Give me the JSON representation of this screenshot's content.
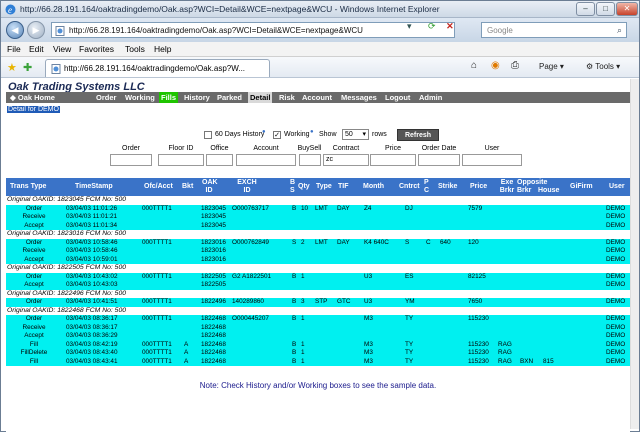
{
  "window": {
    "title": "http://66.28.191.164/oaktradingdemo/Oak.asp?WCI=Detail&WCE=nextpage&WCU - Windows Internet Explorer",
    "minimize": "–",
    "maximize": "□",
    "close": "✕"
  },
  "address": {
    "url": "http://66.28.191.164/oaktradingdemo/Oak.asp?WCI=Detail&WCE=nextpage&WCU",
    "search_placeholder": "Google"
  },
  "menu": [
    "File",
    "Edit",
    "View",
    "Favorites",
    "Tools",
    "Help"
  ],
  "tab": {
    "label": "http://66.28.191.164/oaktradingdemo/Oak.asp?W..."
  },
  "commands": {
    "page": "Page",
    "tools": "Tools"
  },
  "site": {
    "brand": "Oak Trading Systems LLC",
    "nav": [
      "Oak Home",
      "Order",
      "Working",
      "Fills",
      "History",
      "Parked",
      "Detail",
      "Risk",
      "Account",
      "Messages",
      "Logout",
      "Admin"
    ],
    "detail_for": "Detail for DEMO"
  },
  "filters": {
    "history_label": "60 Days History",
    "working_label": "Working",
    "history_checked": false,
    "working_checked": true,
    "show_label": "Show",
    "show_value": "50",
    "rows_label": "rows",
    "refresh": "Refresh",
    "fields": [
      {
        "label": "Order",
        "value": ""
      },
      {
        "label": "Floor ID",
        "value": ""
      },
      {
        "label": "Office",
        "value": ""
      },
      {
        "label": "Account",
        "value": ""
      },
      {
        "label": "BuySell",
        "value": ""
      },
      {
        "label": "Contract",
        "value": "zc"
      },
      {
        "label": "Price",
        "value": ""
      },
      {
        "label": "Order Date",
        "value": ""
      },
      {
        "label": "User",
        "value": ""
      }
    ]
  },
  "grid": {
    "headers": [
      "Trans Type",
      "TimeStamp",
      "Ofc/Acct",
      "Bkt",
      "OAK ID",
      "EXCH ID",
      "B S",
      "Qty",
      "Type",
      "TIF",
      "Month",
      "Cntrct",
      "P C",
      "Strike",
      "Price",
      "Exe Brkr",
      "Opposite Brkr",
      "House",
      "GiFirm",
      "User"
    ],
    "groups": [
      {
        "title": "Original OAKID: 1823045   FCM No: 500",
        "rows": [
          [
            "Order",
            "03/04/03 11:01:26",
            "000TTTT1",
            "",
            "1823045",
            "O000763717",
            "B",
            "10",
            "LMT",
            "DAY",
            "Z4",
            "DJ",
            "",
            "",
            "7579",
            "",
            "",
            "",
            "",
            "DEMO"
          ],
          [
            "Receive",
            "03/04/03 11:01:21",
            "",
            "",
            "1823045",
            "",
            "",
            "",
            "",
            "",
            "",
            "",
            "",
            "",
            "",
            "",
            "",
            "",
            "",
            "DEMO"
          ],
          [
            "Accept",
            "03/04/03 11:01:34",
            "",
            "",
            "1823045",
            "",
            "",
            "",
            "",
            "",
            "",
            "",
            "",
            "",
            "",
            "",
            "",
            "",
            "",
            "DEMO"
          ]
        ]
      },
      {
        "title": "Original OAKID: 1823016   FCM No: 500",
        "rows": [
          [
            "Order",
            "03/04/03 10:58:46",
            "000TTTT1",
            "",
            "1823016",
            "O000762849",
            "S",
            "2",
            "LMT",
            "DAY",
            "K4 640C",
            "S",
            "C",
            "640",
            "120",
            "",
            "",
            "",
            "",
            "DEMO"
          ],
          [
            "Receive",
            "03/04/03 10:58:46",
            "",
            "",
            "1823016",
            "",
            "",
            "",
            "",
            "",
            "",
            "",
            "",
            "",
            "",
            "",
            "",
            "",
            "",
            "DEMO"
          ],
          [
            "Accept",
            "03/04/03 10:59:01",
            "",
            "",
            "1823016",
            "",
            "",
            "",
            "",
            "",
            "",
            "",
            "",
            "",
            "",
            "",
            "",
            "",
            "",
            "DEMO"
          ]
        ]
      },
      {
        "title": "Original OAKID: 1822505   FCM No: 500",
        "rows": [
          [
            "Order",
            "03/04/03 10:43:02",
            "000TTTT1",
            "",
            "1822505",
            "G2 A1822501",
            "B",
            "1",
            "",
            "",
            "U3",
            "ES",
            "",
            "",
            "82125",
            "",
            "",
            "",
            "",
            "DEMO"
          ],
          [
            "Accept",
            "03/04/03 10:43:03",
            "",
            "",
            "1822505",
            "",
            "",
            "",
            "",
            "",
            "",
            "",
            "",
            "",
            "",
            "",
            "",
            "",
            "",
            "DEMO"
          ]
        ]
      },
      {
        "title": "Original OAKID: 1822496   FCM No: 500",
        "rows": [
          [
            "Order",
            "03/04/03 10:41:51",
            "000TTTT1",
            "",
            "1822496",
            "140289860",
            "B",
            "3",
            "STP",
            "GTC",
            "U3",
            "YM",
            "",
            "",
            "7650",
            "",
            "",
            "",
            "",
            "DEMO"
          ]
        ]
      },
      {
        "title": "Original OAKID: 1822468   FCM No: 500",
        "rows": [
          [
            "Order",
            "03/04/03 08:36:17",
            "000TTTT1",
            "",
            "1822468",
            "O000445207",
            "B",
            "1",
            "",
            "",
            "M3",
            "TY",
            "",
            "",
            "115230",
            "",
            "",
            "",
            "",
            "DEMO"
          ],
          [
            "Receive",
            "03/04/03 08:36:17",
            "",
            "",
            "1822468",
            "",
            "",
            "",
            "",
            "",
            "",
            "",
            "",
            "",
            "",
            "",
            "",
            "",
            "",
            "DEMO"
          ],
          [
            "Accept",
            "03/04/03 08:36:29",
            "",
            "",
            "1822468",
            "",
            "",
            "",
            "",
            "",
            "",
            "",
            "",
            "",
            "",
            "",
            "",
            "",
            "",
            "DEMO"
          ],
          [
            "Fill",
            "03/04/03 08:42:19",
            "000TTTT1",
            "A",
            "1822468",
            "",
            "B",
            "1",
            "",
            "",
            "M3",
            "TY",
            "",
            "",
            "115230",
            "RAG",
            "",
            "",
            "",
            "DEMO"
          ],
          [
            "FillDelete",
            "03/04/03 08:43:40",
            "000TTTT1",
            "A",
            "1822468",
            "",
            "B",
            "1",
            "",
            "",
            "M3",
            "TY",
            "",
            "",
            "115230",
            "RAG",
            "",
            "",
            "",
            "DEMO"
          ],
          [
            "Fill",
            "03/04/03 08:43:41",
            "000TTTT1",
            "A",
            "1822468",
            "",
            "B",
            "1",
            "",
            "",
            "M3",
            "TY",
            "",
            "",
            "115230",
            "RAG",
            "BXN",
            "815",
            "",
            "DEMO"
          ]
        ]
      }
    ]
  },
  "note": "Note: Check History and/or Working boxes to see the sample data."
}
